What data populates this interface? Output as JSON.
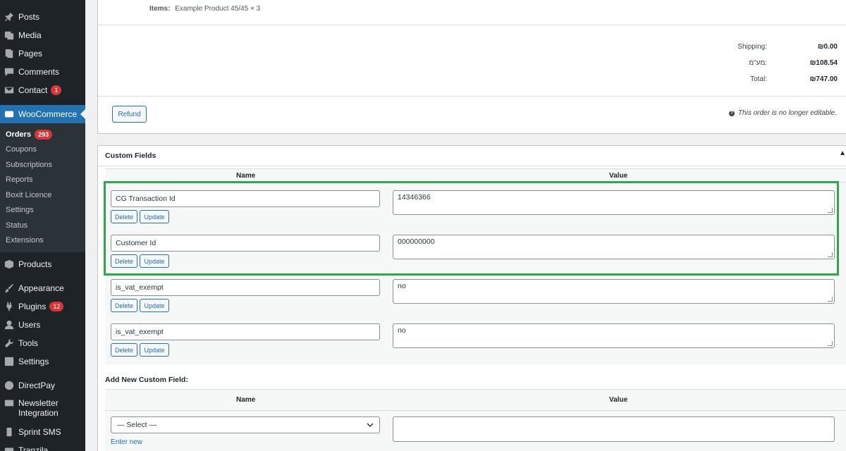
{
  "sidebar": {
    "items_top": [
      {
        "label": "Posts",
        "icon": "pin-icon"
      },
      {
        "label": "Media",
        "icon": "media-icon"
      },
      {
        "label": "Pages",
        "icon": "pages-icon"
      },
      {
        "label": "Comments",
        "icon": "comments-icon"
      },
      {
        "label": "Contact",
        "icon": "mail-icon",
        "badge": "1"
      }
    ],
    "woocommerce": {
      "label": "WooCommerce",
      "icon": "woo-icon"
    },
    "submenu": [
      {
        "label": "Orders",
        "badge": "293"
      },
      {
        "label": "Coupons"
      },
      {
        "label": "Subscriptions"
      },
      {
        "label": "Reports"
      },
      {
        "label": "Boxit Licence"
      },
      {
        "label": "Settings"
      },
      {
        "label": "Status"
      },
      {
        "label": "Extensions"
      }
    ],
    "items_bottom": [
      {
        "label": "Products",
        "icon": "box-icon"
      },
      {
        "label": "Appearance",
        "icon": "brush-icon"
      },
      {
        "label": "Plugins",
        "icon": "plug-icon",
        "badge": "12"
      },
      {
        "label": "Users",
        "icon": "user-icon"
      },
      {
        "label": "Tools",
        "icon": "wrench-icon"
      },
      {
        "label": "Settings",
        "icon": "settings-icon"
      },
      {
        "label": "DirectPay",
        "icon": "gear-icon"
      },
      {
        "label": "Newsletter",
        "label2": "Integration",
        "icon": "mail-icon"
      },
      {
        "label": "Sprint SMS",
        "icon": "phone-icon"
      },
      {
        "label": "Tranzila",
        "icon": "card-icon"
      }
    ]
  },
  "order": {
    "items_label": "Items:",
    "items_value": "Example Product 45/45 × 3",
    "totals": [
      {
        "label": "Shipping:",
        "value": "₪0.00"
      },
      {
        "label": "מע\"מ:",
        "value": "₪108.54"
      },
      {
        "label": "Total:",
        "value": "₪747.00"
      }
    ],
    "refund_label": "Refund",
    "not_editable": "This order is no longer editable."
  },
  "custom_fields": {
    "title": "Custom Fields",
    "col_name": "Name",
    "col_value": "Value",
    "delete_label": "Delete",
    "update_label": "Update",
    "rows": [
      {
        "name": "CG Transaction Id",
        "value": "14346366"
      },
      {
        "name": "Customer Id",
        "value": "000000000"
      },
      {
        "name": "is_vat_exempt",
        "value": "no"
      },
      {
        "name": "is_vat_exempt",
        "value": "no"
      }
    ],
    "add_title": "Add New Custom Field:",
    "select_value": "— Select —",
    "enter_new": "Enter new"
  },
  "colors": {
    "sidebar_bg": "#1d2327",
    "accent": "#2271b1",
    "badge": "#d63638",
    "highlight": "#2ea84a"
  }
}
